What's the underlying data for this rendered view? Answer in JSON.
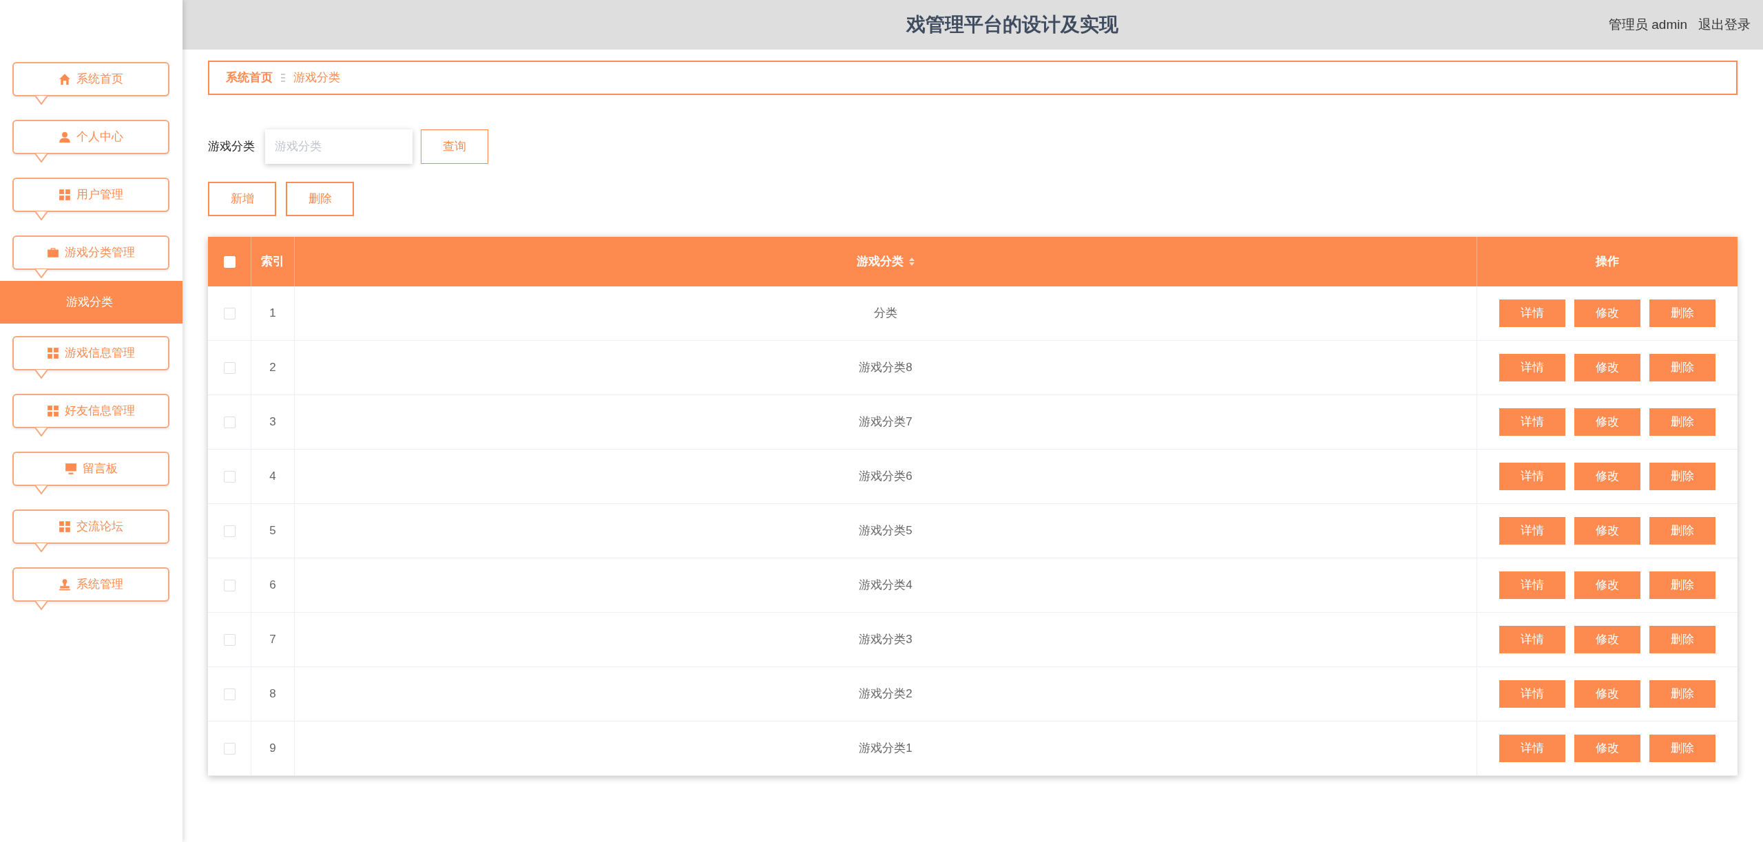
{
  "header": {
    "title": "戏管理平台的设计及实现",
    "user": "管理员 admin",
    "logout": "退出登录"
  },
  "sidebar": {
    "items": [
      {
        "label": "系统首页",
        "kind": "home",
        "selected": false
      },
      {
        "label": "个人中心",
        "kind": "user",
        "selected": false
      },
      {
        "label": "用户管理",
        "kind": "grid",
        "selected": false
      },
      {
        "label": "游戏分类管理",
        "kind": "briefcase",
        "selected": false,
        "children": [
          {
            "label": "游戏分类",
            "selected": true
          }
        ]
      },
      {
        "label": "游戏信息管理",
        "kind": "grid",
        "selected": false
      },
      {
        "label": "好友信息管理",
        "kind": "grid",
        "selected": false
      },
      {
        "label": "留言板",
        "kind": "monitor",
        "selected": false
      },
      {
        "label": "交流论坛",
        "kind": "grid",
        "selected": false
      },
      {
        "label": "系统管理",
        "kind": "stamp",
        "selected": false
      }
    ]
  },
  "breadcrumb": [
    "系统首页",
    "游戏分类"
  ],
  "search": {
    "label": "游戏分类",
    "placeholder": "游戏分类",
    "button": "查询"
  },
  "actions": [
    "新增",
    "删除"
  ],
  "table": {
    "select_all": false,
    "columns": [
      "索引",
      "游戏分类",
      "操作"
    ],
    "rows": [
      {
        "index": "1",
        "category": "分类",
        "checked": false,
        "buttons": [
          "详情",
          "修改",
          "删除"
        ]
      },
      {
        "index": "2",
        "category": "游戏分类8",
        "checked": false,
        "buttons": [
          "详情",
          "修改",
          "删除"
        ]
      },
      {
        "index": "3",
        "category": "游戏分类7",
        "checked": false,
        "buttons": [
          "详情",
          "修改",
          "删除"
        ]
      },
      {
        "index": "4",
        "category": "游戏分类6",
        "checked": false,
        "buttons": [
          "详情",
          "修改",
          "删除"
        ]
      },
      {
        "index": "5",
        "category": "游戏分类5",
        "checked": false,
        "buttons": [
          "详情",
          "修改",
          "删除"
        ]
      },
      {
        "index": "6",
        "category": "游戏分类4",
        "checked": false,
        "buttons": [
          "详情",
          "修改",
          "删除"
        ]
      },
      {
        "index": "7",
        "category": "游戏分类3",
        "checked": false,
        "buttons": [
          "详情",
          "修改",
          "删除"
        ]
      },
      {
        "index": "8",
        "category": "游戏分类2",
        "checked": false,
        "buttons": [
          "详情",
          "修改",
          "删除"
        ]
      },
      {
        "index": "9",
        "category": "游戏分类1",
        "checked": false,
        "buttons": [
          "详情",
          "修改",
          "删除"
        ]
      }
    ]
  }
}
